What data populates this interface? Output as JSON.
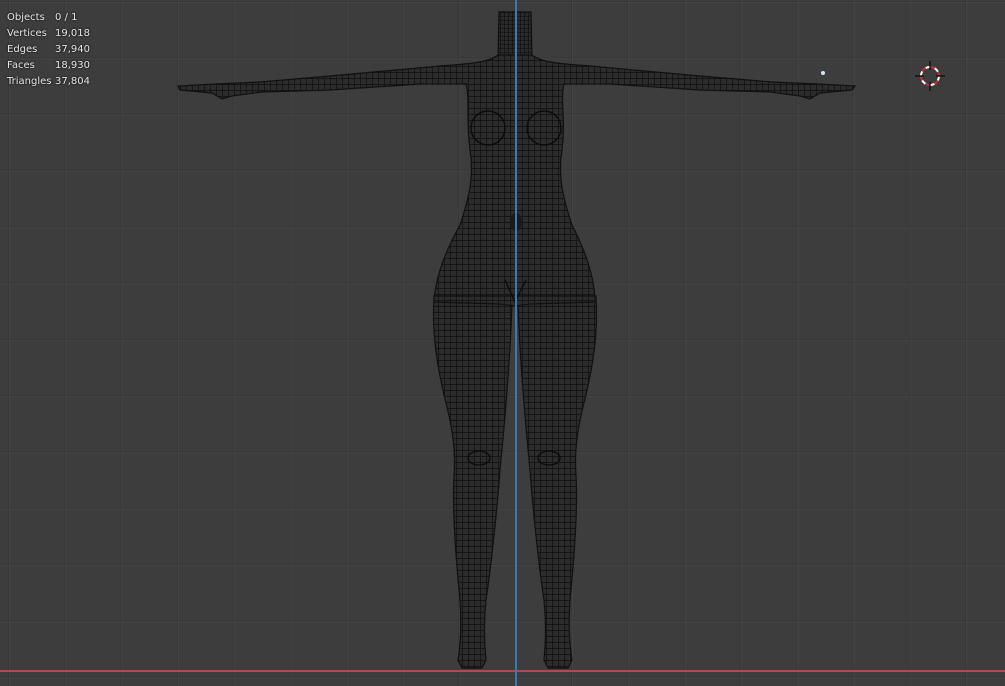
{
  "viewport": {
    "statistics": [
      {
        "label": "Objects",
        "value": "0 / 1"
      },
      {
        "label": "Vertices",
        "value": "19,018"
      },
      {
        "label": "Edges",
        "value": "37,940"
      },
      {
        "label": "Faces",
        "value": "18,930"
      },
      {
        "label": "Triangles",
        "value": "37,804"
      }
    ],
    "colors": {
      "background": "#3d3d3d",
      "axis_x": "#b04a52",
      "axis_z": "#3f7ba8",
      "mesh_fill": "#2c2c2c",
      "wire": "#0e0e0e"
    },
    "icons": [
      "3d-cursor-icon",
      "light-object-icon"
    ]
  }
}
